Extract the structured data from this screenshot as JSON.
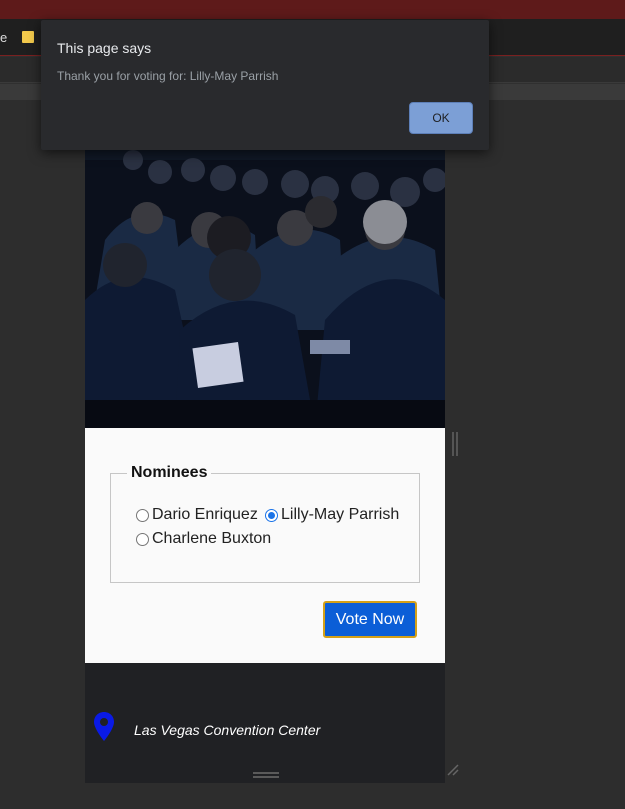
{
  "browser": {
    "bookmark_label": "e",
    "bookmark_folder_icon": "folder-icon"
  },
  "dialog": {
    "title": "This page says",
    "message": "Thank you for voting for: Lilly-May Parrish",
    "ok_label": "OK"
  },
  "page": {
    "hero_image": "audience-photo",
    "nominees": {
      "legend": "Nominees",
      "options": [
        {
          "label": "Dario Enriquez",
          "checked": false
        },
        {
          "label": "Lilly-May Parrish",
          "checked": true
        },
        {
          "label": "Charlene Buxton",
          "checked": false
        }
      ]
    },
    "vote_button": "Vote Now",
    "footer": {
      "location_icon": "map-pin-icon",
      "venue": "Las Vegas Convention Center"
    }
  },
  "colors": {
    "accent": "#0b5ed7",
    "dialog_bg": "#292a2d",
    "ok_button": "#7c9fd6",
    "pin": "#0a1ae6"
  }
}
